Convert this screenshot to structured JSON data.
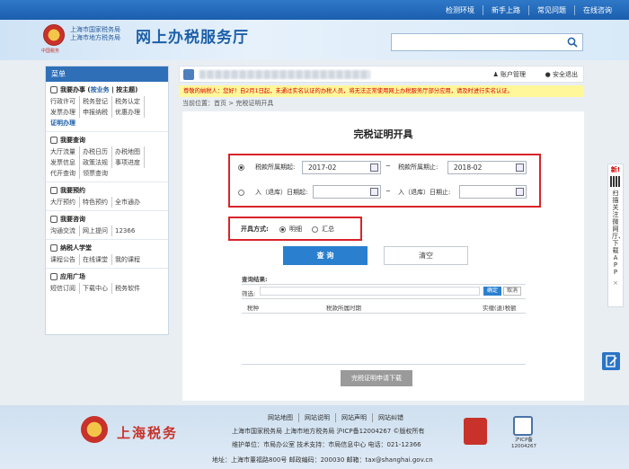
{
  "top_links": [
    "检测环境",
    "新手上路",
    "常见问题",
    "在线咨询"
  ],
  "header": {
    "emblem_caption": "中国税务",
    "bureau_lines": [
      "上海市国家税务局",
      "上海市地方税务局"
    ],
    "site_name": "网上办税服务厅",
    "search_placeholder": ""
  },
  "sidebar": {
    "title": "菜单",
    "sections": [
      {
        "title": "我要办事",
        "extra": [
          "按业务",
          "按主题"
        ],
        "links": [
          "行政许可",
          "税务登记",
          "税务认定",
          "发票办理",
          "申报纳税",
          "优惠办理",
          "证明办理"
        ]
      },
      {
        "title": "我要查询",
        "links": [
          "大厅流量",
          "办税日历",
          "办税地图",
          "发票信息",
          "政策法规",
          "事项进度",
          "代开查询",
          "领票查询"
        ]
      },
      {
        "title": "我要预约",
        "links": [
          "大厅预约",
          "特色预约",
          "全市通办"
        ]
      },
      {
        "title": "我要咨询",
        "links": [
          "沟通交流",
          "网上提问",
          "12366"
        ]
      },
      {
        "title": "纳税人学堂",
        "links": [
          "课程公告",
          "在线课堂",
          "我的课程"
        ]
      },
      {
        "title": "应用广场",
        "links": [
          "短信订阅",
          "下载中心",
          "税务软件"
        ]
      }
    ]
  },
  "user_bar": {
    "account": "账户管理",
    "logout": "安全退出"
  },
  "notice": "尊敬的纳税人：您好！自2月1日起，未通过实名认证的办税人员，将无法正常使用网上办税服务厅部分应用，请及时进行实名认证。",
  "breadcrumb": "当前位置：首页 > 完税证明开具",
  "form": {
    "title": "完税证明开具",
    "period_start_label": "税款所属期起:",
    "period_start_value": "2017-02",
    "period_end_label": "税款所属期止:",
    "period_end_value": "2018-02",
    "tilde": "~",
    "storage_start_label": "入（退库）日期起:",
    "storage_end_label": "入（退库）日期止:",
    "method_label": "开具方式:",
    "method_detail": "明细",
    "method_summary": "汇总",
    "query_button": "查 询",
    "clear_button": "清空",
    "results_title": "查询结果:",
    "filter_label": "筛选:",
    "ok_button": "确定",
    "cancel_button": "取消",
    "columns": [
      "税种",
      "税款所属时期",
      "实缴(退)税额"
    ],
    "download_button": "完税证明申请下载"
  },
  "footer": {
    "links": [
      "网站地图",
      "网站说明",
      "网站声明",
      "网站纠错"
    ],
    "brand": "上海税务",
    "line1": "上海市国家税务局  上海市地方税务局  沪ICP备12004267 ©版权所有",
    "line2": "维护单位：市局办公室   技术支持：市局信息中心 电话：021-12366",
    "line3": "地址：上海市董福路800号   邮政编码：200030   邮箱：tax@shanghai.gov.cn",
    "badge2_text": [
      "沪ICP备",
      "12004267"
    ]
  },
  "app_tab": {
    "new": "新!",
    "text": "扫描关注微网厅、下载APP",
    "close": "×"
  }
}
